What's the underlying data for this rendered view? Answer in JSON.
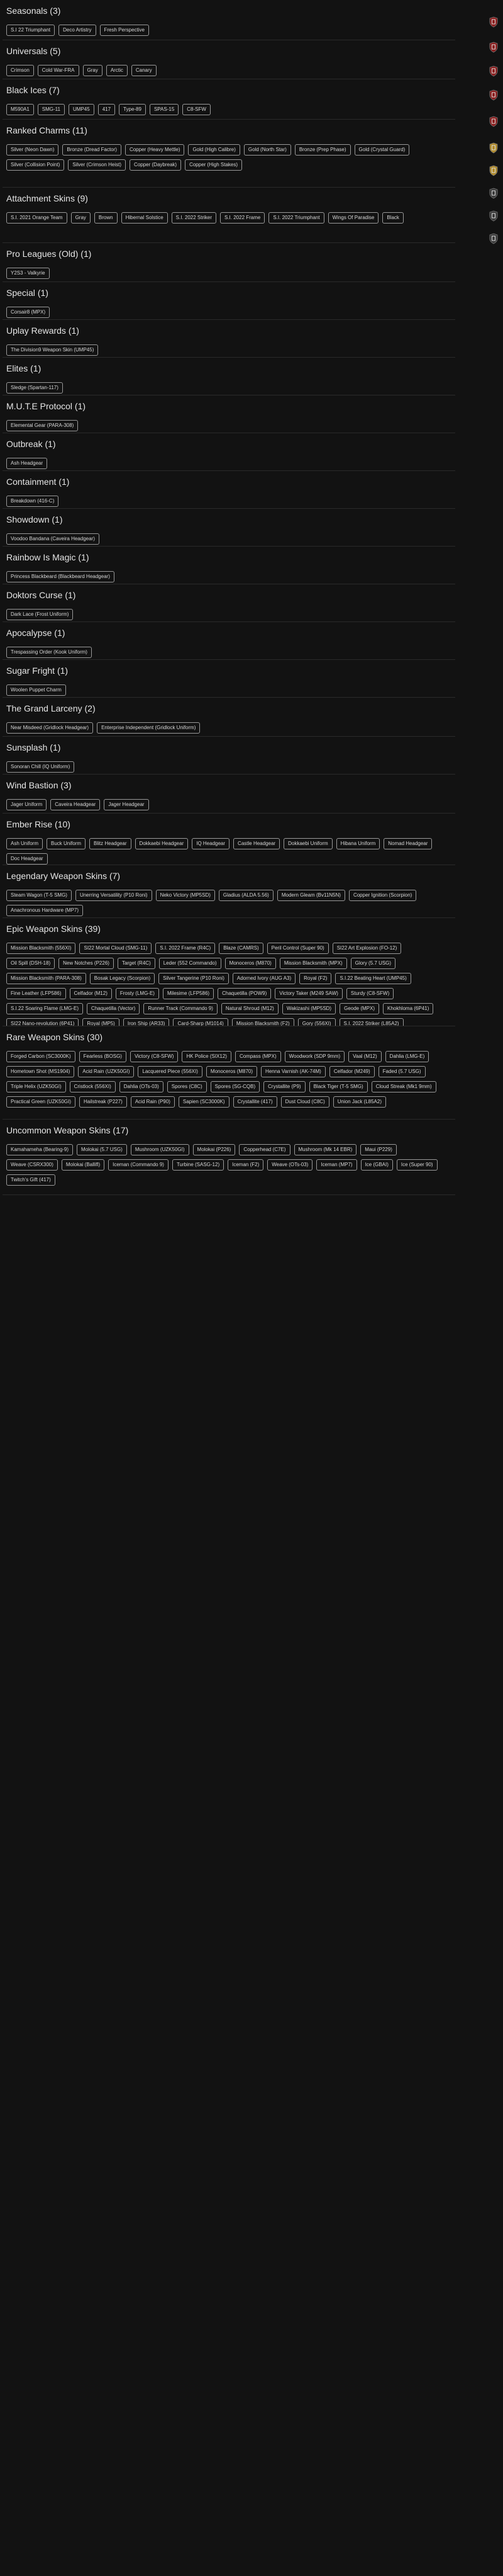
{
  "sections": [
    {
      "title": "Seasonals",
      "count": "(3)",
      "items": [
        "S.I 22 Triumphant",
        "Deco Artistry",
        "Fresh Perspective"
      ]
    },
    {
      "title": "Universals",
      "count": "(5)",
      "items": [
        "Crimson",
        "Cold War-FRA",
        "Gray",
        "Arctic",
        "Canary"
      ]
    },
    {
      "title": "Black Ices",
      "count": "(7)",
      "items": [
        "M590A1",
        "SMG-11",
        "UMP45",
        "417",
        "Type-89",
        "SPAS-15",
        "C8-SFW"
      ]
    },
    {
      "title": "Ranked Charms",
      "count": "(11)",
      "items": [
        "Silver (Neon Dawn)",
        "Bronze (Dread Factor)",
        "Copper (Heavy Mettle)",
        "Gold (High Calibre)",
        "Gold (North Star)",
        "Bronze (Prep Phase)",
        "Gold (Crystal Guard)",
        "Silver (Collision Point)",
        "Silver (Crimson Heist)",
        "Copper (Daybreak)",
        "Copper (High Stakes)"
      ]
    },
    {
      "title": "Attachment Skins",
      "count": "(9)",
      "items": [
        "S.I. 2021 Orange Team",
        "Gray",
        "Brown",
        "Hibernal Solstice",
        "S.I. 2022 Striker",
        "S.I. 2022 Frame",
        "S.I. 2022 Triumphant",
        "Wings Of Paradise",
        "Black"
      ]
    },
    {
      "title": "Pro Leagues (Old)",
      "count": "(1)",
      "items": [
        "Y2S3 - Valkyrie"
      ]
    },
    {
      "title": "Special",
      "count": "(1)",
      "items": [
        "Corsair8 (MPX)"
      ]
    },
    {
      "title": "Uplay Rewards",
      "count": "(1)",
      "items": [
        "The Division9 Weapon Skin (UMP45)"
      ]
    },
    {
      "title": "Elites",
      "count": "(1)",
      "items": [
        "Sledge (Spartan-117)"
      ]
    },
    {
      "title": "M.U.T.E Protocol",
      "count": "(1)",
      "items": [
        "Elemental Gear (PARA-308)"
      ]
    },
    {
      "title": "Outbreak",
      "count": "(1)",
      "items": [
        "Ash Headgear"
      ]
    },
    {
      "title": "Containment",
      "count": "(1)",
      "items": [
        "Breakdown (416-C)"
      ]
    },
    {
      "title": "Showdown",
      "count": "(1)",
      "items": [
        "Voodoo Bandana (Caveira Headgear)"
      ]
    },
    {
      "title": "Rainbow Is Magic",
      "count": "(1)",
      "items": [
        "Princess Blackbeard (Blackbeard Headgear)"
      ]
    },
    {
      "title": "Doktors Curse",
      "count": "(1)",
      "items": [
        "Dark Lace (Frost Uniform)"
      ]
    },
    {
      "title": "Apocalypse",
      "count": "(1)",
      "items": [
        "Trespassing Order (Kook Uniform)"
      ]
    },
    {
      "title": "Sugar Fright",
      "count": "(1)",
      "items": [
        "Woolen Puppet Charm"
      ]
    },
    {
      "title": "The Grand Larceny",
      "count": "(2)",
      "items": [
        "Near Misdeed (Gridlock Headgear)",
        "Enterprise Independent (Gridlock Uniform)"
      ]
    },
    {
      "title": "Sunsplash",
      "count": "(1)",
      "items": [
        "Sonoran Chill (IQ Uniform)"
      ]
    },
    {
      "title": "Wind Bastion",
      "count": "(3)",
      "items": [
        "Jager Uniform",
        "Caveira Headgear",
        "Jager Headgear"
      ]
    },
    {
      "title": "Ember Rise",
      "count": "(10)",
      "items": [
        "Ash Uniform",
        "Buck Uniform",
        "Blitz Headgear",
        "Dokkaebi Headgear",
        "IQ Headgear",
        "Castle Headgear",
        "Dokkaebi Uniform",
        "Hibana Uniform",
        "Nomad Headgear",
        "Doc Headgear"
      ]
    },
    {
      "title": "Legendary Weapon Skins",
      "count": "(7)",
      "items": [
        "Steam Wagon (T-5 SMG)",
        "Unerring Versatility (P10 Roni)",
        "Neko Victory (MP5SD)",
        "Gladius (ALDA 5.56)",
        "Modern Gleam (Bv11N5N)",
        "Copper Ignition (Scorpion)",
        "Anachronous Hardware (MP7)"
      ]
    },
    {
      "title": "Epic Weapon Skins",
      "count": "(39)",
      "items": [
        "Mission Blacksmith (556XI)",
        "SI22 Mortal Cloud (SMG-11)",
        "S.I. 2022 Frame (R4C)",
        "Blaze (CAMRS)",
        "Peril Control (Super 90)",
        "SI22 Art Explosion (FO-12)",
        "Oil Spill (DSH-18)",
        "New Notches (P226)",
        "Target (R4C)",
        "Leder (552 Commando)",
        "Monoceros (M870)",
        "Mission Blacksmith (MPX)",
        "Glory (5.7 USG)",
        "Mission Blacksmith (PARA-308)",
        "Bosak Legacy (Scorpion)",
        "Silver Tangerine (P10 Roni)",
        "Adorned Ivory (AUG A3)",
        "Royal (F2)",
        "S.I.22 Beating Heart (UMP45)",
        "Fine Leather (LFP586)",
        "Celfador (M12)",
        "Frosty (LMG-E)",
        "Milesime (LFP586)",
        "Chaquetilla (POW9)",
        "Victory Taker (M249 SAW)",
        "Sturdy (C8-SFW)",
        "S.I.22 Soaring Flame (LMG-E)",
        "Chaquetilla (Vector)",
        "Runner Track (Commando 9)",
        "Natural Shroud (M12)",
        "Wakizashi (MP5SD)",
        "Geode (MPX)",
        "Khokhloma (6P41)",
        "SI22 Nano-revolution (6P41)",
        "Royal (MP5)",
        "Iron Ship (AR33)",
        "Card-Sharp (M1014)",
        "Mission Blacksmith (F2)",
        "Gory (556XI)",
        "S.I. 2022 Striker (L85A2)"
      ]
    },
    {
      "title": "Rare Weapon Skins",
      "count": "(30)",
      "items": [
        "Forged Carbon (SC3000K)",
        "Fearless (BOSG)",
        "Victory (C8-SFW)",
        "HK Police (SIX12)",
        "Compass (MPX)",
        "Woodwork (SDP 9mm)",
        "Vaal (M12)",
        "Dahlia (LMG-E)",
        "Hometown Shot (MS1904)",
        "Acid Rain (UZK50GI)",
        "Lacquered Piece (556XI)",
        "Monoceros (M870)",
        "Henna Varnish (AK-74M)",
        "Celfador (M249)",
        "Faded (5.7 USG)",
        "Triple Helix (UZK50GI)",
        "Cristlock (556XI)",
        "Dahlia (OTs-03)",
        "Spores (C8C)",
        "Spores (SG-CQB)",
        "Crystallite (P9)",
        "Black Tiger (T-5 SMG)",
        "Cloud Streak (Mk1 9mm)",
        "Practical Green (UZK50GI)",
        "Hailstreak (P227)",
        "Acid Rain (P90)",
        "Sapien (SC3000K)",
        "Crystallite (417)",
        "Dust Cloud (C8C)",
        "Union Jack (L85A2)"
      ]
    },
    {
      "title": "Uncommon Weapon Skins",
      "count": "(17)",
      "items": [
        "Kamahameha (Bearing-9)",
        "Molokai (5.7 USG)",
        "Mushroom (UZK50GI)",
        "Molokai (P226)",
        "Copperhead (C7E)",
        "Mushroom (Mk 14 EBR)",
        "Maui (P229)",
        "Weave (CSRX300)",
        "Molokai (Ballifl)",
        "Iceman (Commando 9)",
        "Turbine (SASG-12)",
        "Iceman (F2)",
        "Weave (OTs-03)",
        "Iceman (MP7)",
        "Ice (GBAI)",
        "Ice (Super 90)",
        "Twitch's Gift (417)"
      ]
    }
  ],
  "rail_icons": [
    "badge-red-icon",
    "badge-red-icon",
    "badge-red-icon",
    "badge-red-icon",
    "badge-red-icon",
    "badge-gold-icon",
    "badge-gold-icon",
    "badge-dark-icon",
    "badge-dark-icon",
    "badge-dark-icon"
  ],
  "colors": {
    "background": "#121212",
    "chip_border": "#9a9a9a",
    "text": "#e6e6e6",
    "divider": "#2a2a2a",
    "badge_red": "#8a1c1c",
    "badge_gold": "#b08a2a",
    "badge_dark": "#3a3a3a"
  }
}
